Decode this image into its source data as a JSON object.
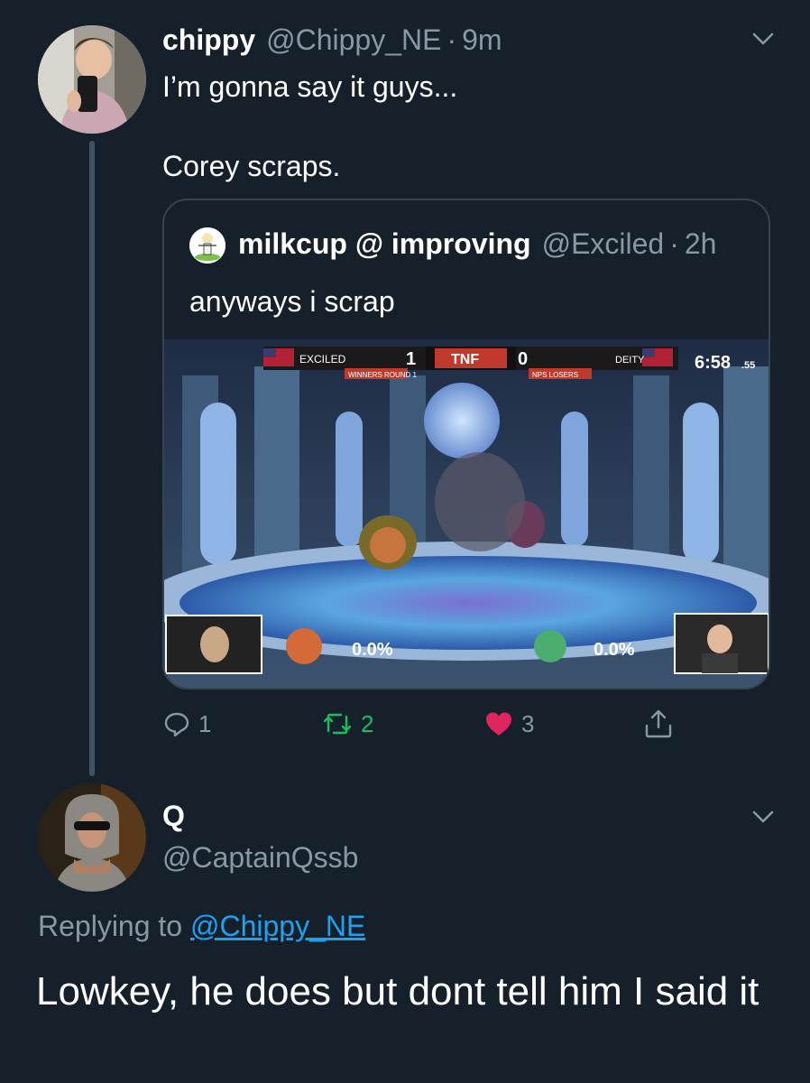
{
  "tweet1": {
    "name": "chippy",
    "handle": "@Chippy_NE",
    "separator": "·",
    "time": "9m",
    "text_line1": "I’m gonna say it guys...",
    "text_line2": "Corey scraps.",
    "actions": {
      "reply_count": "1",
      "retweet_count": "2",
      "like_count": "3"
    }
  },
  "quote": {
    "name": "milkcup @ improving",
    "handle": "@Exciled",
    "separator": "·",
    "time": "2h",
    "text": "anyways i scrap",
    "media": {
      "left_tag": "EXCILED",
      "left_score": "1",
      "center_logo": "TNF",
      "right_score": "0",
      "right_tag": "DEITY",
      "round_left": "WINNERS ROUND 1",
      "round_right": "NPS LOSERS",
      "timer": "6:58",
      "timer_ms": ".55",
      "p1_percent": "0.0%",
      "p2_percent": "0.0%"
    }
  },
  "tweet2": {
    "name": "Q",
    "handle": "@CaptainQssb",
    "replying_prefix": "Replying to",
    "replying_handle": "@Chippy_NE",
    "text": "Lowkey, he does but dont tell him I said it"
  },
  "colors": {
    "background": "#15202b",
    "secondary_text": "#8899a6",
    "link": "#1da1f2",
    "retweet_green": "#17bf63",
    "like_pink": "#e0245e",
    "border": "#38444d"
  },
  "icons": [
    "chevron-down-icon",
    "reply-icon",
    "retweet-icon",
    "like-icon",
    "share-icon"
  ]
}
